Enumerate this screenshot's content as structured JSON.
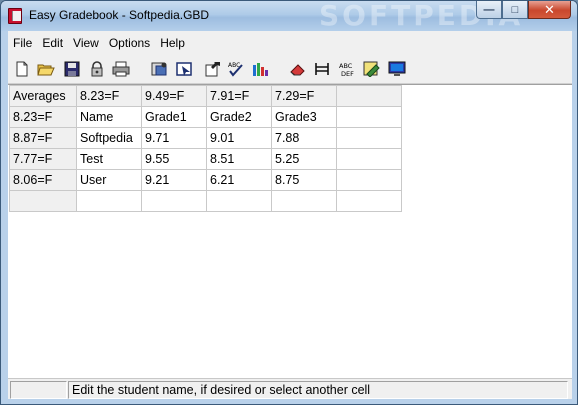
{
  "window": {
    "title": "Easy Gradebook - Softpedia.GBD",
    "watermark": "SOFTPEDIA",
    "min_glyph": "—",
    "max_glyph": "□",
    "close_glyph": "✕"
  },
  "menu": [
    "File",
    "Edit",
    "View",
    "Options",
    "Help"
  ],
  "toolbar": {
    "items": [
      "new-file",
      "open-folder",
      "save",
      "lock",
      "print",
      "configure",
      "select",
      "export",
      "spellcheck",
      "chart",
      "eraser",
      "columns",
      "abc-sort",
      "format",
      "monitor"
    ]
  },
  "grid": {
    "columns": [
      "Averages",
      "8.23=F",
      "9.49=F",
      "7.91=F",
      "7.29=F",
      ""
    ],
    "rows": [
      [
        "8.23=F",
        "Name",
        "Grade1",
        "Grade2",
        "Grade3",
        ""
      ],
      [
        "8.87=F",
        "Softpedia",
        "9.71",
        "9.01",
        "7.88",
        ""
      ],
      [
        "7.77=F",
        "Test",
        "9.55",
        "8.51",
        "5.25",
        ""
      ],
      [
        "8.06=F",
        "User",
        "9.21",
        "6.21",
        "8.75",
        ""
      ],
      [
        "",
        "",
        "",
        "",
        "",
        ""
      ]
    ]
  },
  "status": {
    "left": "",
    "message": "Edit the student name, if desired or select another cell"
  },
  "colors": {
    "frame": "#b9d1ea",
    "fixed_cell": "#f0f0f0",
    "close_button": "#c9472d"
  }
}
